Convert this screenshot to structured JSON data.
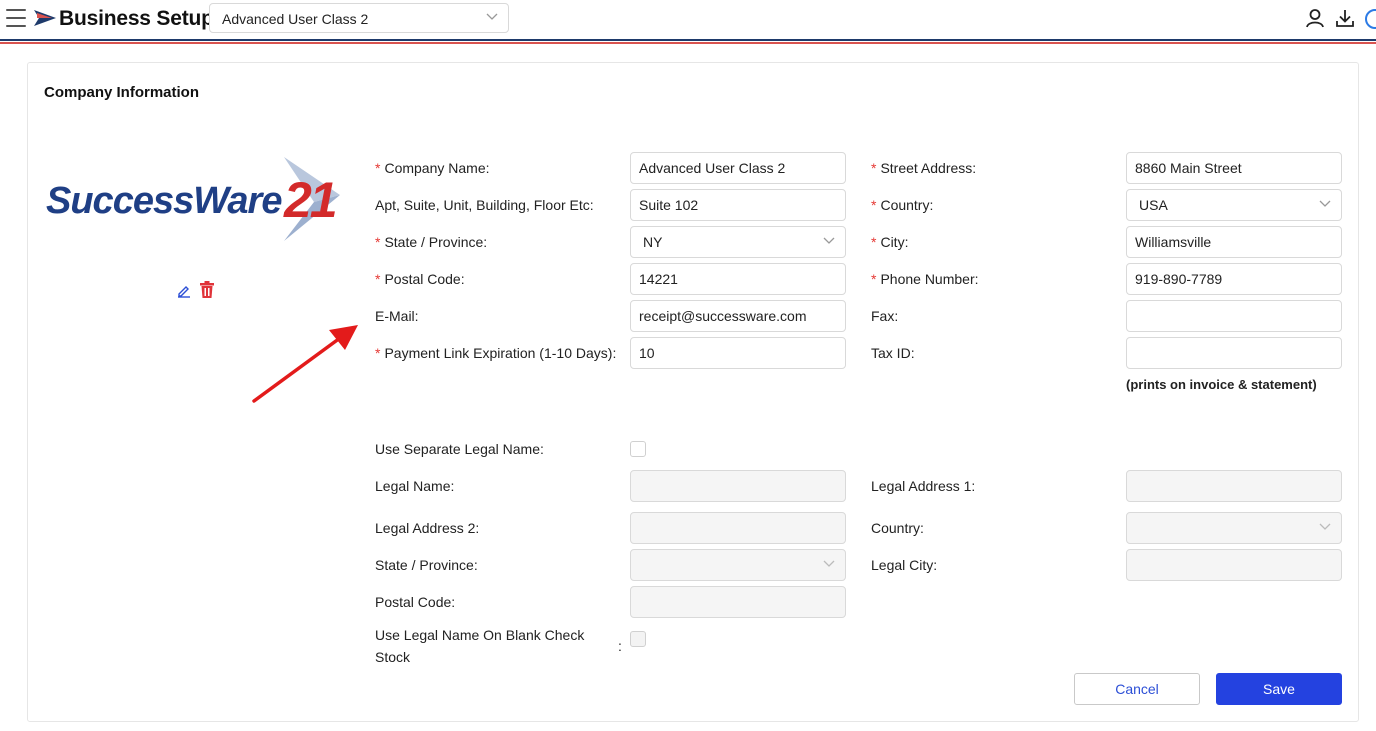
{
  "header": {
    "title": "Business Setup",
    "business_selector": {
      "value": "Advanced User Class 2"
    }
  },
  "card": {
    "title": "Company Information",
    "logo": {
      "text": "SuccessWare",
      "number": "21"
    }
  },
  "form": {
    "company_name": {
      "label": "Company Name",
      "value": "Advanced User Class 2",
      "required": true
    },
    "apt_suite": {
      "label": "Apt, Suite, Unit, Building, Floor Etc",
      "value": "Suite 102",
      "required": false
    },
    "state_province": {
      "label": "State / Province",
      "value": "NY",
      "required": true
    },
    "postal_code": {
      "label": "Postal Code",
      "value": "14221",
      "required": true
    },
    "email": {
      "label": "E-Mail",
      "value": "receipt@successware.com",
      "required": false
    },
    "payment_link_expiration": {
      "label": "Payment Link Expiration (1-10 Days)",
      "value": "10",
      "required": true
    },
    "street_address": {
      "label": "Street Address",
      "value": "8860 Main Street",
      "required": true
    },
    "country": {
      "label": "Country",
      "value": "USA",
      "required": true
    },
    "city": {
      "label": "City",
      "value": "Williamsville",
      "required": true
    },
    "phone_number": {
      "label": "Phone Number",
      "value": "919-890-7789",
      "required": true
    },
    "fax": {
      "label": "Fax",
      "value": "",
      "required": false
    },
    "tax_id": {
      "label": "Tax ID",
      "value": "",
      "required": false,
      "hint": "(prints on invoice & statement)"
    },
    "use_separate_legal_name": {
      "label": "Use Separate Legal Name",
      "checked": false
    },
    "legal_name": {
      "label": "Legal Name",
      "value": ""
    },
    "legal_address_1": {
      "label": "Legal Address 1",
      "value": ""
    },
    "legal_address_2": {
      "label": "Legal Address 2",
      "value": ""
    },
    "legal_country": {
      "label": "Country",
      "value": ""
    },
    "legal_state_province": {
      "label": "State / Province",
      "value": ""
    },
    "legal_city": {
      "label": "Legal City",
      "value": ""
    },
    "legal_postal_code": {
      "label": "Postal Code",
      "value": ""
    },
    "use_legal_name_on_check": {
      "label": "Use Legal Name On Blank Check Stock",
      "checked": false
    }
  },
  "buttons": {
    "cancel": "Cancel",
    "save": "Save"
  },
  "colors": {
    "primary": "#2442e0",
    "required": "#e53935",
    "delete": "#e0343a",
    "edit": "#2c4fd6",
    "annotation_arrow": "#e31b1b"
  }
}
